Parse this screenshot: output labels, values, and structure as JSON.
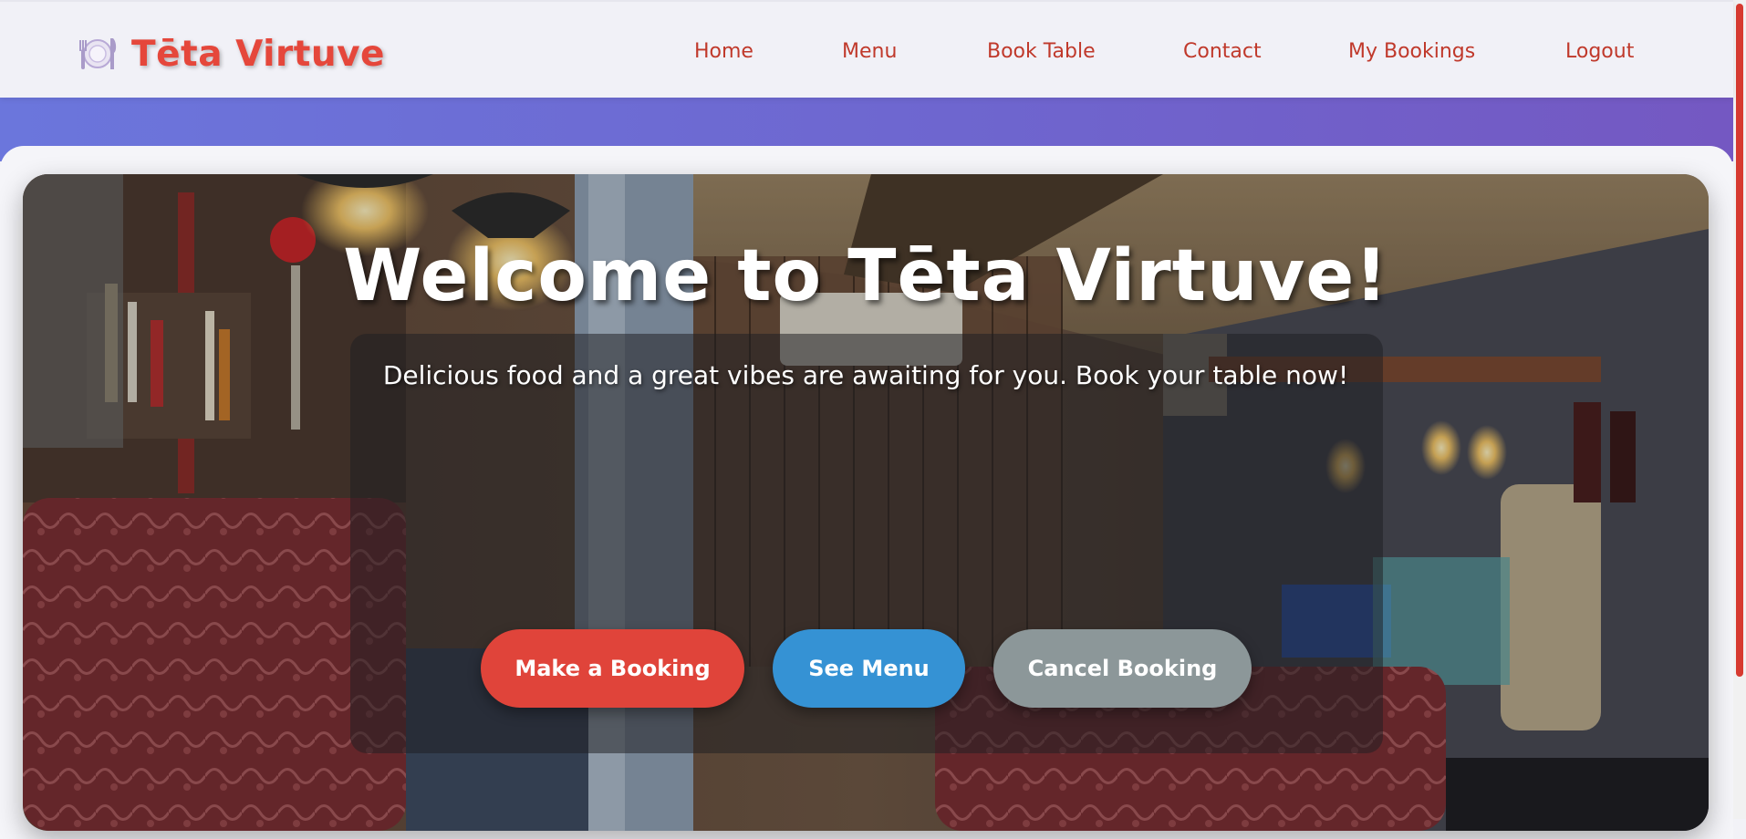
{
  "brand": {
    "name": "Tēta Virtuve",
    "icon": "plate-cutlery-icon"
  },
  "nav": {
    "items": [
      {
        "label": "Home"
      },
      {
        "label": "Menu"
      },
      {
        "label": "Book Table"
      },
      {
        "label": "Contact"
      },
      {
        "label": "My Bookings"
      },
      {
        "label": "Logout"
      }
    ]
  },
  "hero": {
    "title": "Welcome to Tēta Virtuve!",
    "subtitle": "Delicious food and a great vibes are awaiting for you. Book your table now!",
    "buttons": {
      "book": "Make a Booking",
      "menu": "See Menu",
      "cancel": "Cancel Booking"
    }
  },
  "colors": {
    "brand": "#e5473b",
    "nav_link": "#c0392b",
    "band_start": "#6b76dc",
    "band_end": "#7458c2",
    "btn_book": "#e0443a",
    "btn_menu": "#3592d4",
    "btn_cancel": "#8c9799"
  }
}
